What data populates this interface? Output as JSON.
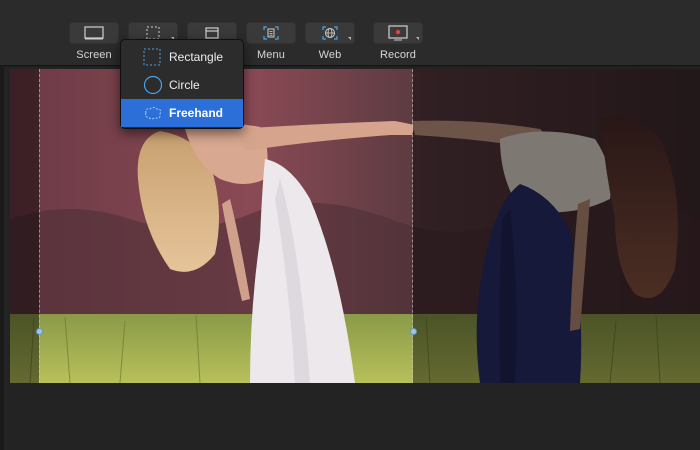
{
  "toolbar": {
    "tools": [
      {
        "label": "Screen",
        "icon": "screen-icon"
      },
      {
        "label": "",
        "icon": "region-icon"
      },
      {
        "label": "",
        "icon": "window-icon"
      },
      {
        "label": "Menu",
        "icon": "menu-icon"
      },
      {
        "label": "Web",
        "icon": "globe-icon"
      },
      {
        "label": "Record",
        "icon": "record-icon"
      }
    ]
  },
  "selection_menu": {
    "items": [
      {
        "label": "Rectangle",
        "icon": "rectangle-icon",
        "selected": false
      },
      {
        "label": "Circle",
        "icon": "circle-icon",
        "selected": false
      },
      {
        "label": "Freehand",
        "icon": "freehand-icon",
        "selected": true
      }
    ]
  },
  "colors": {
    "toolbar_bg": "#2b2b2b",
    "menu_highlight": "#2d6fd8",
    "icon_accent": "#4aa3e8",
    "record_accent": "#e0443a"
  }
}
